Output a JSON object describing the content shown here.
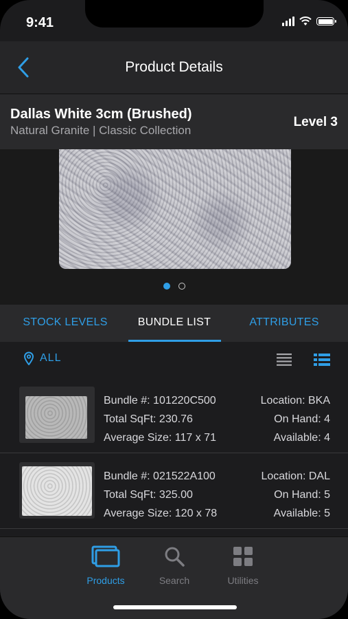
{
  "status_bar": {
    "time": "9:41"
  },
  "nav": {
    "title": "Product Details",
    "back_icon": "chevron-left-icon"
  },
  "product": {
    "name": "Dallas White 3cm (Brushed)",
    "subtitle": "Natural Granite | Classic Collection",
    "level": "Level 3"
  },
  "gallery": {
    "page_count": 2,
    "current_page": 1
  },
  "tabs": [
    {
      "label": "STOCK LEVELS",
      "selected": false
    },
    {
      "label": "BUNDLE LIST",
      "selected": true
    },
    {
      "label": "ATTRIBUTES",
      "selected": false
    }
  ],
  "filter": {
    "location_label": "ALL",
    "location_icon": "map-pin-icon",
    "view_mode": "detail"
  },
  "bundles": [
    {
      "bundle": "Bundle #: 101220C500",
      "sqft": "Total SqFt: 230.76",
      "avg_size": "Average Size: 117 x 71",
      "location": "Location: BKA",
      "on_hand": "On Hand: 4",
      "available": "Available: 4"
    },
    {
      "bundle": "Bundle #: 021522A100",
      "sqft": "Total SqFt: 325.00",
      "avg_size": "Average Size: 120 x 78",
      "location": "Location: DAL",
      "on_hand": "On Hand: 5",
      "available": "Available: 5"
    }
  ],
  "tabbar": {
    "items": [
      {
        "label": "Products",
        "icon": "products-icon",
        "selected": true
      },
      {
        "label": "Search",
        "icon": "search-icon",
        "selected": false
      },
      {
        "label": "Utilities",
        "icon": "grid-icon",
        "selected": false
      }
    ]
  },
  "colors": {
    "accent": "#2f9ee6",
    "background": "#1c1c1e",
    "surface": "#2a2a2c",
    "inactive": "#7d7d82"
  }
}
